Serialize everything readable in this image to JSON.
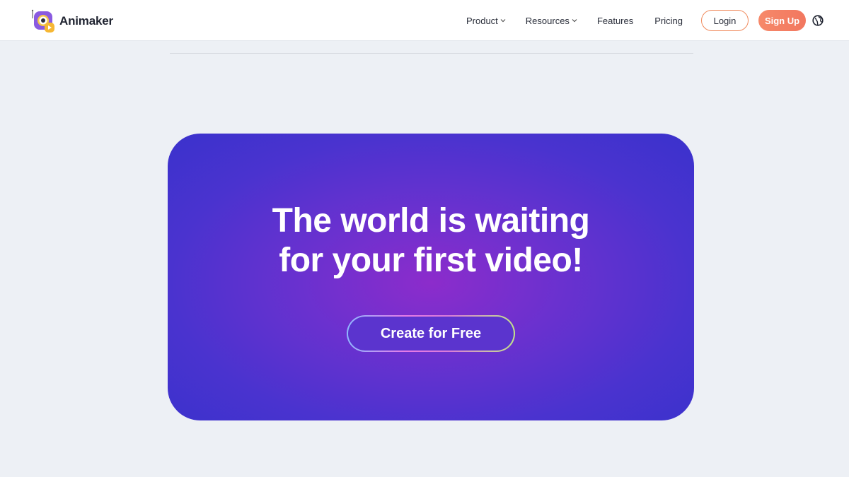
{
  "brand": {
    "name": "Animaker"
  },
  "nav": {
    "items": [
      {
        "label": "Product",
        "has_dropdown": true
      },
      {
        "label": "Resources",
        "has_dropdown": true
      },
      {
        "label": "Features",
        "has_dropdown": false
      },
      {
        "label": "Pricing",
        "has_dropdown": false
      }
    ],
    "login_label": "Login",
    "signup_label": "Sign Up",
    "language_icon": "globe-icon"
  },
  "hero": {
    "title_line1": "The world is waiting",
    "title_line2": "for your first video!",
    "cta_label": "Create for Free"
  },
  "colors": {
    "page_bg": "#edf0f5",
    "accent_orange": "#f2775f",
    "hero_blue": "#3a32cc",
    "hero_purple": "#8c2ccb"
  }
}
